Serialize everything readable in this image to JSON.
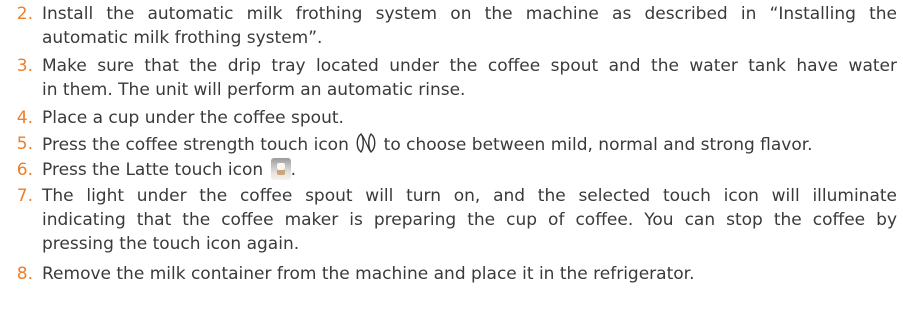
{
  "steps": [
    {
      "number": "2.",
      "lines": [
        "Install the automatic milk frothing system on the machine as described in “Installing the",
        "automatic milk frothing system”."
      ]
    },
    {
      "number": "3.",
      "lines": [
        "Make sure that the drip tray located under the coffee spout and the water tank have water",
        "in them. The unit will perform an automatic rinse."
      ]
    },
    {
      "number": "4.",
      "lines": [
        "Place a cup under the coffee spout."
      ]
    },
    {
      "number": "5.",
      "before_icon": "Press the coffee strength touch icon",
      "icon": "coffee-strength-icon",
      "after_icon": "to choose between mild, normal and strong flavor."
    },
    {
      "number": "6.",
      "before_icon": "Press the Latte touch icon",
      "icon": "latte-icon",
      "after_icon": "."
    },
    {
      "number": "7.",
      "lines": [
        "The light under the coffee spout will turn on, and the selected touch icon will illuminate",
        "indicating that the coffee maker is preparing the cup of coffee. You can stop the coffee by",
        "pressing the touch icon again."
      ]
    },
    {
      "number": "8.",
      "lines": [
        "Remove the milk container from the machine and place it in the refrigerator."
      ]
    }
  ],
  "colors": {
    "number": "#f07e26",
    "text": "#3a3a3a"
  }
}
